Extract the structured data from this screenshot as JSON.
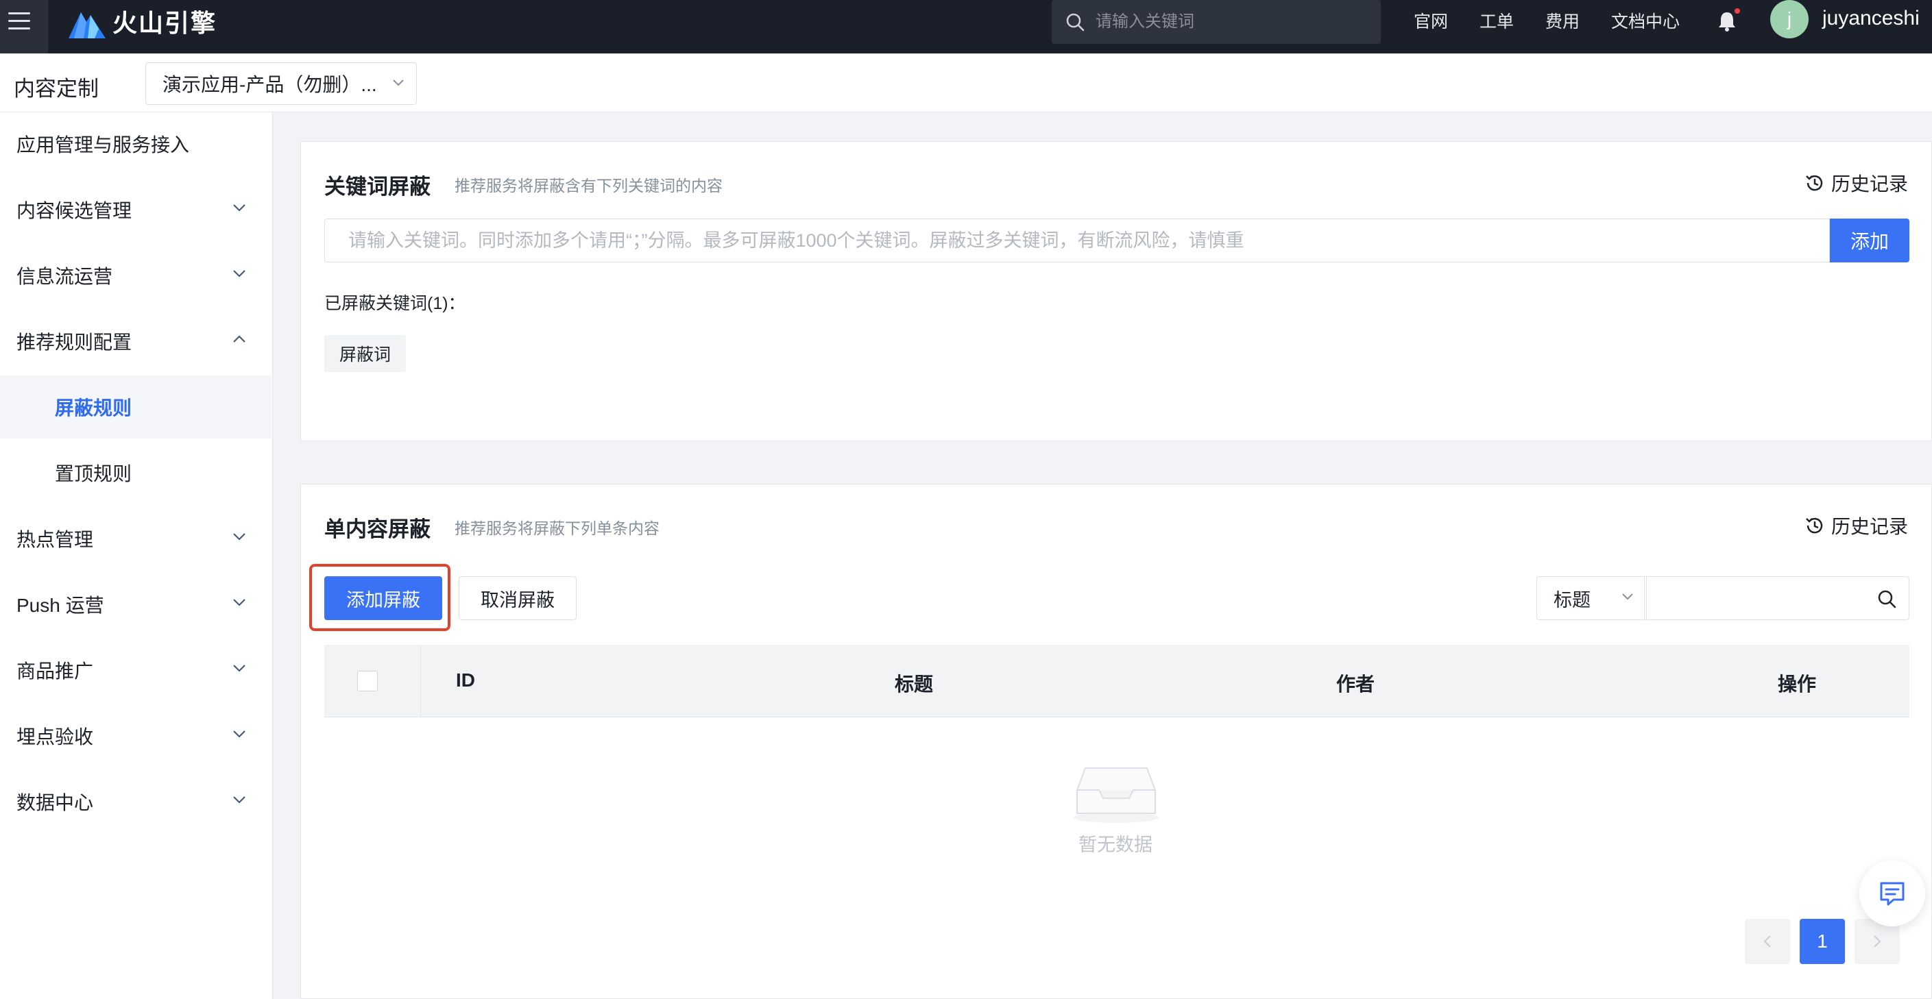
{
  "header": {
    "logo_text": "火山引擎",
    "search_placeholder": "请输入关键词",
    "nav": [
      "官网",
      "工单",
      "费用",
      "文档中心"
    ],
    "avatar_letter": "j",
    "username": "juyanceshi"
  },
  "subheader": {
    "title": "内容定制",
    "app_select_value": "演示应用-产品（勿删）..."
  },
  "sidebar": {
    "items": [
      {
        "label": "应用管理与服务接入",
        "expandable": false,
        "expanded": false
      },
      {
        "label": "内容候选管理",
        "expandable": true,
        "expanded": false
      },
      {
        "label": "信息流运营",
        "expandable": true,
        "expanded": false
      },
      {
        "label": "推荐规则配置",
        "expandable": true,
        "expanded": true
      },
      {
        "label": "屏蔽规则",
        "sub": true,
        "active": true
      },
      {
        "label": "置顶规则",
        "sub": true,
        "active": false
      },
      {
        "label": "热点管理",
        "expandable": true,
        "expanded": false
      },
      {
        "label": "Push 运营",
        "expandable": true,
        "expanded": false
      },
      {
        "label": "商品推广",
        "expandable": true,
        "expanded": false
      },
      {
        "label": "埋点验收",
        "expandable": true,
        "expanded": false
      },
      {
        "label": "数据中心",
        "expandable": true,
        "expanded": false
      }
    ]
  },
  "keyword_block": {
    "title": "关键词屏蔽",
    "desc": "推荐服务将屏蔽含有下列关键词的内容",
    "history_label": "历史记录",
    "input_placeholder": "请输入关键词。同时添加多个请用“；”分隔。最多可屏蔽1000个关键词。屏蔽过多关键词，有断流风险，请慎重",
    "add_label": "添加",
    "blocked_label": "已屏蔽关键词(1)：",
    "tags": [
      "屏蔽词"
    ]
  },
  "content_block": {
    "title": "单内容屏蔽",
    "desc": "推荐服务将屏蔽下列单条内容",
    "history_label": "历史记录",
    "add_block_label": "添加屏蔽",
    "cancel_block_label": "取消屏蔽",
    "filter_select_value": "标题",
    "filter_input_value": "",
    "columns": [
      "ID",
      "标题",
      "作者",
      "操作"
    ],
    "empty_text": "暂无数据",
    "pagination": {
      "current": "1"
    }
  },
  "colors": {
    "primary": "#3a72f5",
    "topbar": "#1b1f2a",
    "highlight": "#e0432c"
  }
}
